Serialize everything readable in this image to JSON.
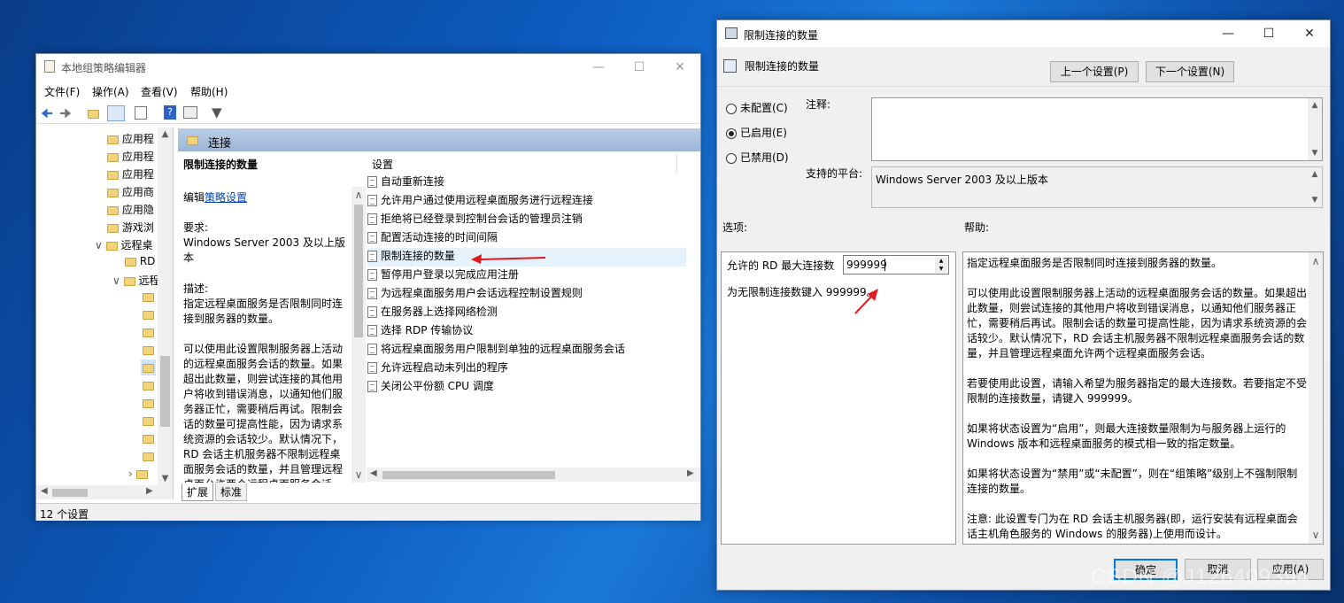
{
  "left": {
    "title": "本地组策略编辑器",
    "menu": [
      "文件(F)",
      "操作(A)",
      "查看(V)",
      "帮助(H)"
    ],
    "tree": [
      "应用程",
      "应用程",
      "应用程",
      "应用商",
      "应用隐",
      "游戏浏",
      "远程桌",
      "RD",
      "远程"
    ],
    "header": "连接",
    "desc_title": "限制连接的数量",
    "edit_prefix": "编辑",
    "edit_link": "策略设置",
    "req_label": "要求:",
    "req_text": "Windows Server 2003 及以上版本",
    "desc_label": "描述:",
    "desc_text": "指定远程桌面服务是否限制同时连接到服务器的数量。\n\n可以使用此设置限制服务器上活动的远程桌面服务会话的数量。如果超出此数量，则尝试连接的其他用户将收到错误消息，以通知他们服务器正忙，需要稍后再试。限制会话的数量可提高性能，因为请求系统资源的会话较少。默认情况下，RD 会话主机服务器不限制远程桌面服务会话的数量，并且管理远程桌面允许两个远程桌面服务会话。",
    "list_header": "设置",
    "settings": [
      "自动重新连接",
      "允许用户通过使用远程桌面服务进行远程连接",
      "拒绝将已经登录到控制台会话的管理员注销",
      "配置活动连接的时间间隔",
      "限制连接的数量",
      "暂停用户登录以完成应用注册",
      "为远程桌面服务用户会话远程控制设置规则",
      "在服务器上选择网络检测",
      "选择 RDP 传输协议",
      "将远程桌面服务用户限制到单独的远程桌面服务会话",
      "允许远程启动未列出的程序",
      "关闭公平份额 CPU 调度"
    ],
    "tabs": [
      "扩展",
      "标准"
    ],
    "status": "12 个设置"
  },
  "dialog": {
    "title": "限制连接的数量",
    "policy_name": "限制连接的数量",
    "prev_btn": "上一个设置(P)",
    "next_btn": "下一个设置(N)",
    "radio_not_configured": "未配置(C)",
    "radio_enabled": "已启用(E)",
    "radio_disabled": "已禁用(D)",
    "comment_label": "注释:",
    "platform_label": "支持的平台:",
    "platform_value": "Windows Server 2003 及以上版本",
    "options_label": "选项:",
    "help_label": "帮助:",
    "max_label": "允许的 RD 最大连接数",
    "max_value": "999999",
    "unlimited_hint": "为无限制连接数键入 999999。",
    "help_text": "指定远程桌面服务是否限制同时连接到服务器的数量。\n\n可以使用此设置限制服务器上活动的远程桌面服务会话的数量。如果超出此数量，则尝试连接的其他用户将收到错误消息，以通知他们服务器正忙，需要稍后再试。限制会话的数量可提高性能，因为请求系统资源的会话较少。默认情况下，RD 会话主机服务器不限制远程桌面服务会话的数量，并且管理远程桌面允许两个远程桌面服务会话。\n\n若要使用此设置，请输入希望为服务器指定的最大连接数。若要指定不受限制的连接数量，请键入 999999。\n\n如果将状态设置为“启用”，则最大连接数量限制为与服务器上运行的 Windows 版本和远程桌面服务的模式相一致的指定数量。\n\n如果将状态设置为“禁用”或“未配置”，则在“组策略”级别上不强制限制连接的数量。\n\n注意: 此设置专门为在 RD 会话主机服务器(即，运行安装有远程桌面会话主机角色服务的 Windows 的服务器)上使用而设计。",
    "ok": "确定",
    "cancel": "取消",
    "apply": "应用(A)"
  },
  "watermark": "CSDN @J126409394"
}
